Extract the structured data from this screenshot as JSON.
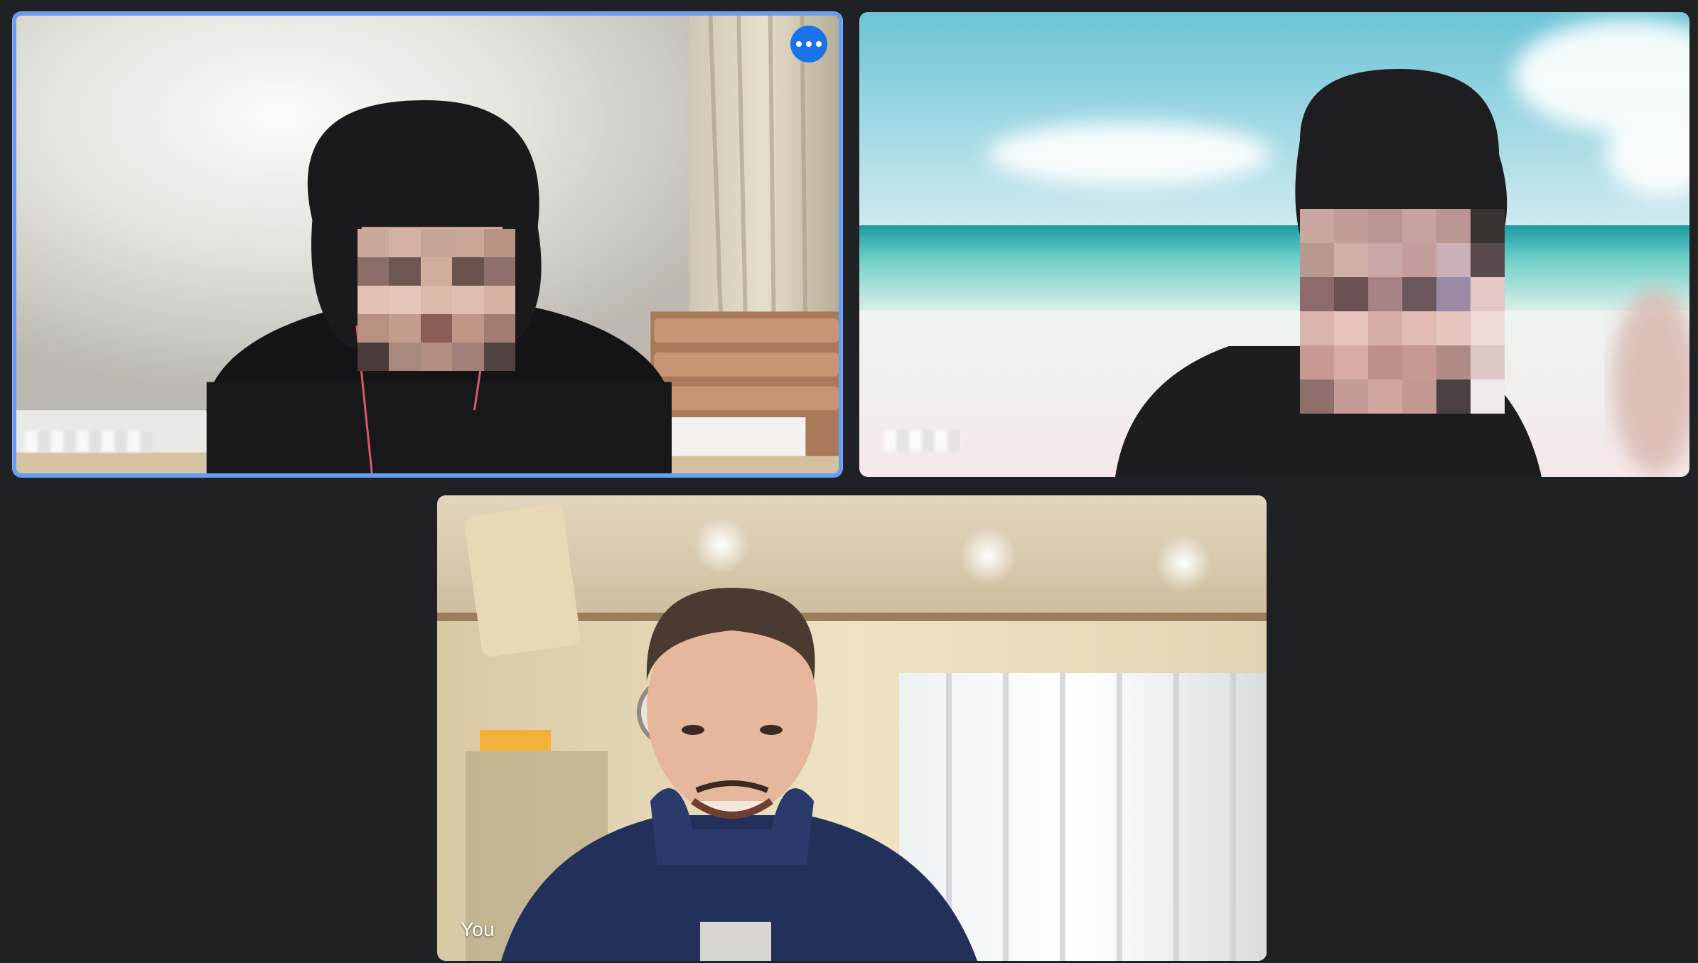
{
  "participants": [
    {
      "id": "participant-1",
      "name": "",
      "speaking": true,
      "more_options_label": "More options"
    },
    {
      "id": "participant-2",
      "name": "",
      "speaking": false
    },
    {
      "id": "self",
      "name": "You",
      "speaking": false
    }
  ],
  "colors": {
    "background": "#202124",
    "speaking_border": "#669df6",
    "more_button": "#1a73e8"
  },
  "icons": {
    "more_options": "more-horiz-icon"
  }
}
